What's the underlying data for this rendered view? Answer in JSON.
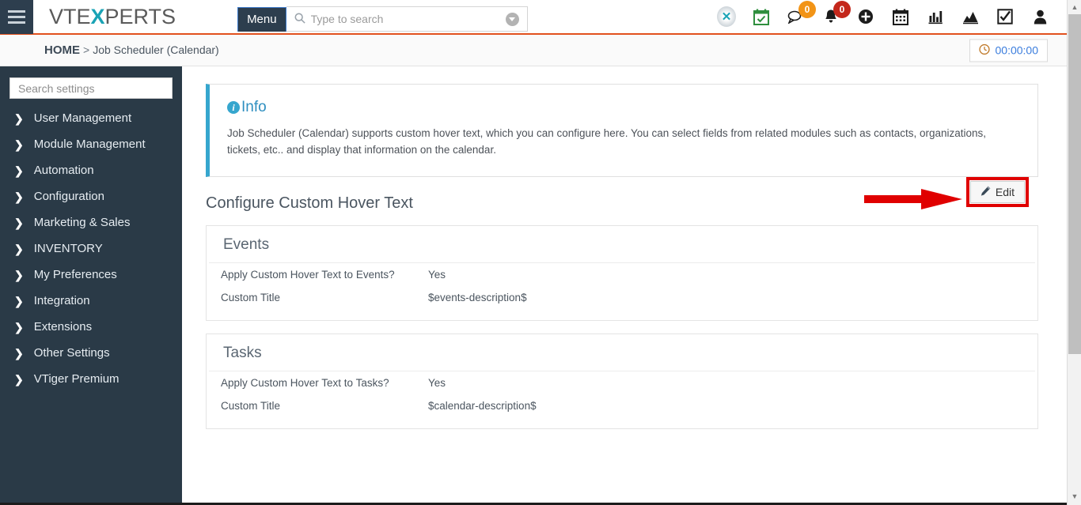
{
  "header": {
    "logo_text_1": "VTE",
    "logo_text_x": "X",
    "logo_text_2": "PERTS",
    "menu_label": "Menu",
    "search_placeholder": "Type to search",
    "search_value": "",
    "icons": [
      {
        "name": "xwheel-icon",
        "label": "X"
      },
      {
        "name": "calendar-check-icon",
        "label": ""
      },
      {
        "name": "chat-icon",
        "label": "",
        "badge": "0",
        "badge_color": "#f29417"
      },
      {
        "name": "bell-icon",
        "label": "",
        "badge": "0",
        "badge_color": "#c4271b"
      },
      {
        "name": "add-circle-icon",
        "label": ""
      },
      {
        "name": "calendar-icon",
        "label": ""
      },
      {
        "name": "bar-chart-icon",
        "label": ""
      },
      {
        "name": "area-chart-icon",
        "label": ""
      },
      {
        "name": "checkbox-icon",
        "label": ""
      },
      {
        "name": "user-icon",
        "label": ""
      }
    ]
  },
  "breadcrumb": {
    "home": "HOME",
    "separator": ">",
    "current": "Job Scheduler (Calendar)"
  },
  "timer": {
    "value": "00:00:00",
    "icon": "clock-icon"
  },
  "sidebar": {
    "search_placeholder": "Search settings",
    "search_value": "",
    "items": [
      {
        "label": "User Management"
      },
      {
        "label": "Module Management"
      },
      {
        "label": "Automation"
      },
      {
        "label": "Configuration"
      },
      {
        "label": "Marketing & Sales"
      },
      {
        "label": "INVENTORY"
      },
      {
        "label": "My Preferences"
      },
      {
        "label": "Integration"
      },
      {
        "label": "Extensions"
      },
      {
        "label": "Other Settings"
      },
      {
        "label": "VTiger Premium"
      }
    ]
  },
  "info": {
    "title": "Info",
    "body": "Job Scheduler (Calendar) supports custom hover text, which you can configure here. You can select fields from related modules such as contacts, organizations, tickets, etc.. and display that information on the calendar."
  },
  "main": {
    "section_title": "Configure Custom Hover Text",
    "edit_label": "Edit",
    "panels": [
      {
        "heading": "Events",
        "rows": [
          {
            "label": "Apply Custom Hover Text to Events?",
            "value": "Yes"
          },
          {
            "label": "Custom Title",
            "value": "$events-description$"
          }
        ]
      },
      {
        "heading": "Tasks",
        "rows": [
          {
            "label": "Apply Custom Hover Text to Tasks?",
            "value": "Yes"
          },
          {
            "label": "Custom Title",
            "value": "$calendar-description$"
          }
        ]
      }
    ]
  },
  "colors": {
    "sidebar_bg": "#2a3a47",
    "accent_orange": "#e2511e",
    "info_border": "#36a6ce",
    "logo_x": "#1aa3b5",
    "annotation_red": "#e00000",
    "timer_text": "#3b7ddd"
  }
}
